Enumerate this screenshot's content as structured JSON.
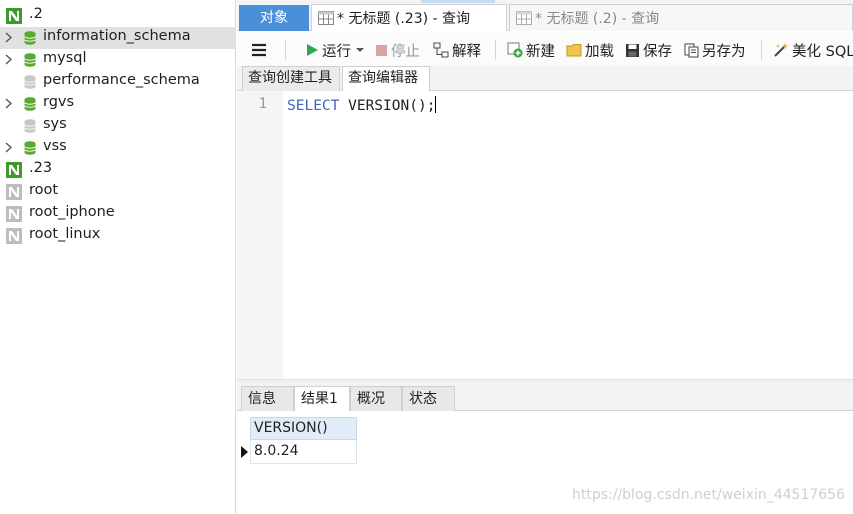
{
  "sidebar": {
    "items": [
      {
        "label": ".2",
        "icon": "connection-icon"
      },
      {
        "label": "information_schema",
        "icon": "database-icon",
        "expandable": true,
        "selected": true
      },
      {
        "label": "mysql",
        "icon": "database-icon",
        "expandable": true
      },
      {
        "label": "performance_schema",
        "icon": "database-closed-icon"
      },
      {
        "label": "rgvs",
        "icon": "database-icon",
        "expandable": true
      },
      {
        "label": "sys",
        "icon": "database-closed-icon"
      },
      {
        "label": "vss",
        "icon": "database-icon",
        "expandable": true
      },
      {
        "label": ".23",
        "icon": "connection-icon"
      },
      {
        "label": "root",
        "icon": "connection-closed-icon"
      },
      {
        "label": "root_iphone",
        "icon": "connection-closed-icon"
      },
      {
        "label": "root_linux",
        "icon": "connection-closed-icon"
      }
    ]
  },
  "tabs": {
    "object": "对象",
    "active_query": "* 无标题 (.23) - 查询",
    "inactive_query": "* 无标题 (.2) - 查询"
  },
  "toolbar": {
    "run": "运行",
    "stop": "停止",
    "explain": "解释",
    "new": "新建",
    "load": "加载",
    "save": "保存",
    "save_as": "另存为",
    "beautify": "美化 SQL"
  },
  "editor_tabs": {
    "builder": "查询创建工具",
    "editor": "查询编辑器"
  },
  "editor": {
    "line_number": "1",
    "keyword": "SELECT",
    "rest": " VERSION();"
  },
  "result_tabs": {
    "info": "信息",
    "result1": "结果1",
    "profile": "概况",
    "status": "状态"
  },
  "results": {
    "columns": [
      "VERSION()"
    ],
    "rows": [
      [
        "8.0.24"
      ]
    ]
  },
  "watermark": "https://blog.csdn.net/weixin_44517656",
  "colors": {
    "accent": "#4a90d9",
    "db_icon": "#5aa92f",
    "keyword": "#3b66c4"
  }
}
